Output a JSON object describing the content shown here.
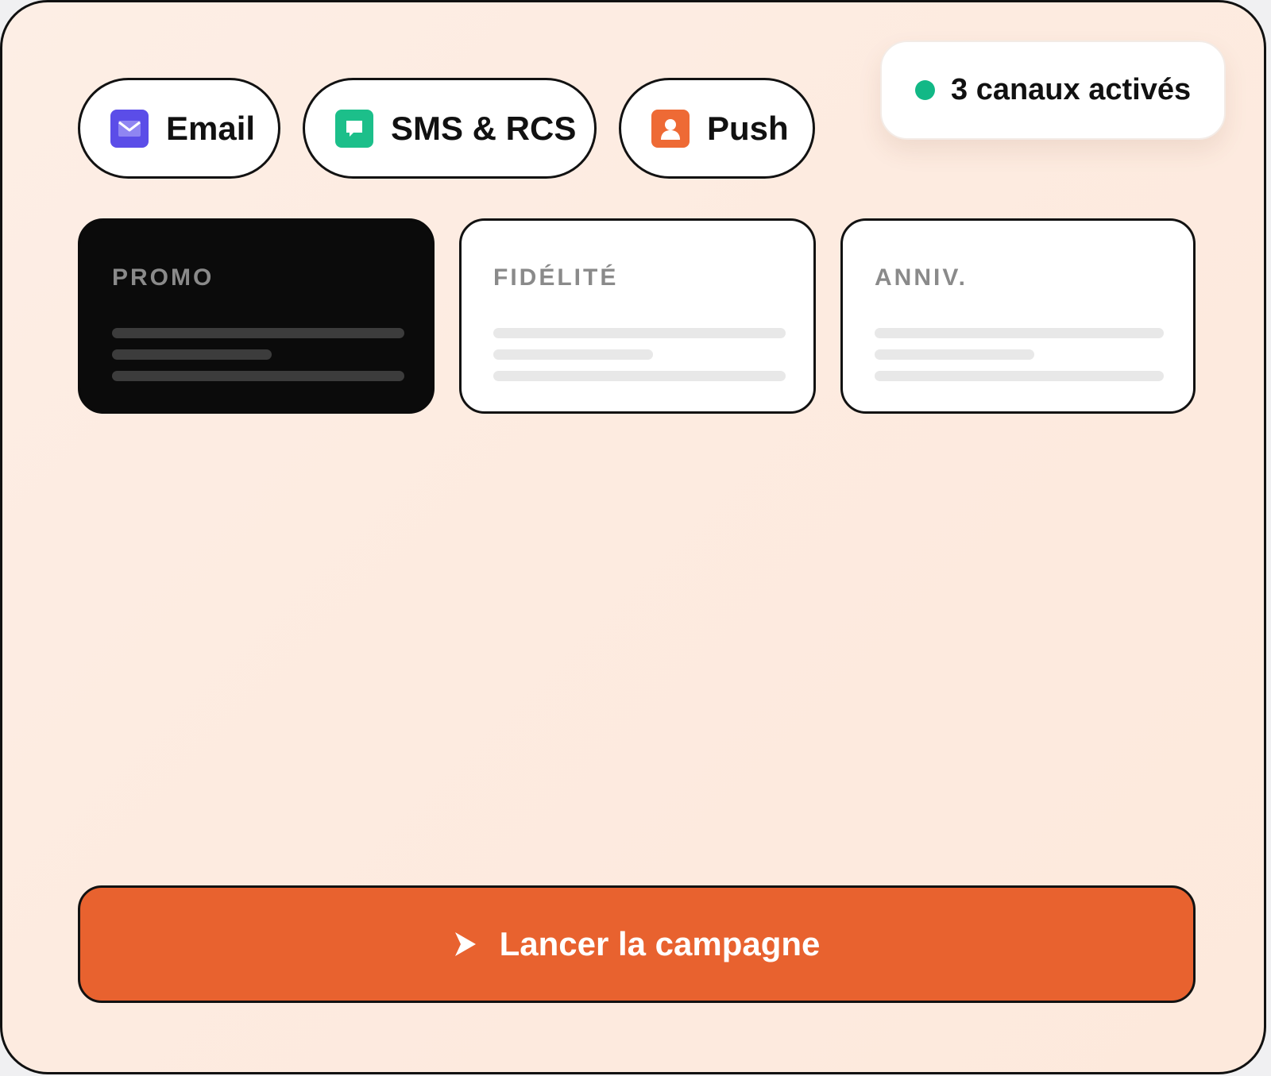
{
  "channels": {
    "email": {
      "label": "Email",
      "icon": "mail-icon",
      "color": "#5b4de8"
    },
    "sms": {
      "label": "SMS & RCS",
      "icon": "chat-bubble-icon",
      "color": "#1cbf8a"
    },
    "push": {
      "label": "Push",
      "icon": "user-icon",
      "color": "#ee6a35"
    }
  },
  "status": {
    "text": "3 canaux activés",
    "dot_color": "#12b886"
  },
  "templates": [
    {
      "label": "PROMO",
      "selected": true
    },
    {
      "label": "FIDÉLITÉ",
      "selected": false
    },
    {
      "label": "ANNIV.",
      "selected": false
    }
  ],
  "launch": {
    "label": "Lancer la campagne",
    "icon": "play-icon",
    "color": "#e8622f"
  }
}
